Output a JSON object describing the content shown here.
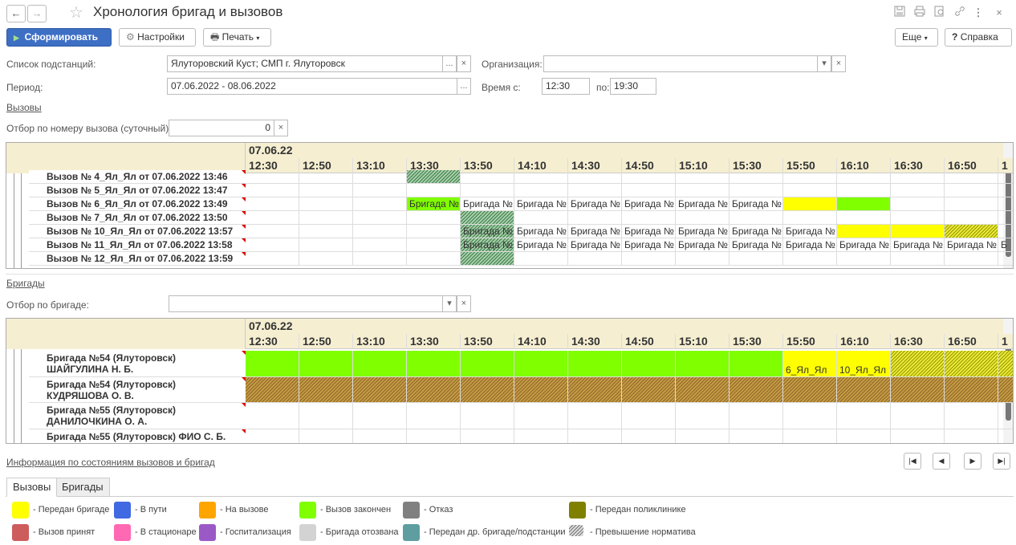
{
  "window": {
    "title": "Хронология бригад и вызовов",
    "back_icon": "←",
    "forward_icon": "→",
    "star_icon": "☆"
  },
  "toolbar": {
    "run_label": "Сформировать",
    "settings_label": "Настройки",
    "print_label": "Печать",
    "more_label": "Еще",
    "help_label": "Справка"
  },
  "form": {
    "substations_label": "Список подстанций:",
    "substations_value": "Ялуторовский Куст; СМП г. Ялуторовск",
    "organization_label": "Организация:",
    "organization_value": "",
    "period_label": "Период:",
    "period_value": "07.06.2022 - 08.06.2022",
    "time_from_label": "Время с:",
    "time_from_value": "12:30",
    "time_to_label": "по:",
    "time_to_value": "19:30",
    "calls_link": "Вызовы",
    "call_filter_label": "Отбор по номеру вызова (суточный):",
    "call_filter_value": "0",
    "brigades_link": "Бригады",
    "brigade_filter_label": "Отбор по бригаде:",
    "brigade_filter_value": ""
  },
  "calls_grid": {
    "date": "07.06.22",
    "times": [
      "12:30",
      "12:50",
      "13:10",
      "13:30",
      "13:50",
      "14:10",
      "14:30",
      "14:50",
      "15:10",
      "15:30",
      "15:50",
      "16:10",
      "16:30",
      "16:50",
      "1"
    ],
    "rows": [
      {
        "label": "Вызов № 4_Ял_Ял от 07.06.2022 13:46",
        "cells": [
          "",
          "",
          "",
          "hatch",
          "",
          "",
          "",
          "",
          "",
          "",
          "",
          "",
          "",
          "",
          ""
        ]
      },
      {
        "label": "Вызов № 5_Ял_Ял от 07.06.2022 13:47",
        "cells": [
          "",
          "",
          "",
          "",
          "",
          "",
          "",
          "",
          "",
          "",
          "",
          "",
          "",
          "",
          ""
        ]
      },
      {
        "label": "Вызов № 6_Ял_Ял от 07.06.2022 13:49",
        "cells": [
          "",
          "",
          "",
          "green:Бригада №",
          "Бригада №",
          "Бригада №",
          "Бригада №",
          "Бригада №",
          "Бригада №",
          "Бригада №",
          "yellow",
          "green",
          "",
          "",
          ""
        ]
      },
      {
        "label": "Вызов № 7_Ял_Ял от 07.06.2022 13:50",
        "cells": [
          "",
          "",
          "",
          "",
          "hatch",
          "",
          "",
          "",
          "",
          "",
          "",
          "",
          "",
          "",
          ""
        ]
      },
      {
        "label": "Вызов № 10_Ял_Ял от 07.06.2022 13:57",
        "cells": [
          "",
          "",
          "",
          "",
          "hatch:Бригада №",
          "Бригада №",
          "Бригада №",
          "Бригада №",
          "Бригада №",
          "Бригада №",
          "Бригада №",
          "yellow",
          "yellow",
          "hatchy",
          ""
        ]
      },
      {
        "label": "Вызов № 11_Ял_Ял от 07.06.2022 13:58",
        "cells": [
          "",
          "",
          "",
          "",
          "hatch:Бригада №",
          "Бригада №",
          "Бригада №",
          "Бригада №",
          "Бригада №",
          "Бригада №",
          "Бригада №",
          "Бригада №",
          "Бригада №",
          "Бригада №",
          "Б"
        ]
      },
      {
        "label": "Вызов № 12_Ял_Ял от 07.06.2022 13:59",
        "cells": [
          "",
          "",
          "",
          "",
          "hatch",
          "",
          "",
          "",
          "",
          "",
          "",
          "",
          "",
          "",
          ""
        ]
      }
    ]
  },
  "brigades_grid": {
    "date": "07.06.22",
    "times": [
      "12:30",
      "12:50",
      "13:10",
      "13:30",
      "13:50",
      "14:10",
      "14:30",
      "14:50",
      "15:10",
      "15:30",
      "15:50",
      "16:10",
      "16:30",
      "16:50",
      "1"
    ],
    "rows": [
      {
        "line1": "Бригада №54 (Ялуторовск)",
        "line2": "ШАЙГУЛИНА Н. Б.",
        "cells": [
          "green",
          "green",
          "green",
          "green",
          "green",
          "green",
          "green",
          "green",
          "green",
          "green",
          "yellow:6_Ял_Ял",
          "yellow:10_Ял_Ял",
          "hatchy",
          "hatchy",
          "hatchy"
        ]
      },
      {
        "line1": "Бригада №54 (Ялуторовск)",
        "line2": "КУДРЯШОВА О. В.",
        "cells": [
          "hatchb",
          "hatchb",
          "hatchb",
          "hatchb",
          "hatchb",
          "hatchb",
          "hatchb",
          "hatchb",
          "hatchb",
          "hatchb",
          "hatchb",
          "hatchb",
          "hatchb",
          "hatchb",
          "hatchb"
        ]
      },
      {
        "line1": "Бригада №55 (Ялуторовск)",
        "line2": "ДАНИЛОЧКИНА О. А.",
        "cells": [
          "",
          "",
          "",
          "",
          "",
          "",
          "",
          "",
          "",
          "",
          "",
          "",
          "",
          "",
          ""
        ]
      },
      {
        "line1": "Бригада №55 (Ялуторовск) ФИО С. Б.",
        "line2": "",
        "cells": [
          "",
          "",
          "",
          "",
          "",
          "",
          "",
          "",
          "",
          "",
          "",
          "",
          "",
          "",
          ""
        ]
      }
    ]
  },
  "info_link": "Информация по состояниям вызовов и бригад",
  "tabs": [
    "Вызовы",
    "Бригады"
  ],
  "legend": [
    {
      "color": "#ffff00",
      "label": "- Передан бригаде"
    },
    {
      "color": "#4169e1",
      "label": "- В пути"
    },
    {
      "color": "#ffa500",
      "label": "- На вызове"
    },
    {
      "color": "#80ff00",
      "label": "- Вызов закончен"
    },
    {
      "color": "#808080",
      "label": "- Отказ"
    },
    {
      "color": "#808000",
      "label": "- Передан поликлинике"
    },
    {
      "color": "#cd5c5c",
      "label": "- Вызов принят"
    },
    {
      "color": "#ff69b4",
      "label": "- В стационаре"
    },
    {
      "color": "#9b59c6",
      "label": "- Госпитализация"
    },
    {
      "color": "#d3d3d3",
      "label": "- Бригада отозвана"
    },
    {
      "color": "#5f9ea0",
      "label": "- Передан др. бригаде/подстанции"
    },
    {
      "color": "hatch",
      "label": "- Превышение норматива"
    }
  ]
}
